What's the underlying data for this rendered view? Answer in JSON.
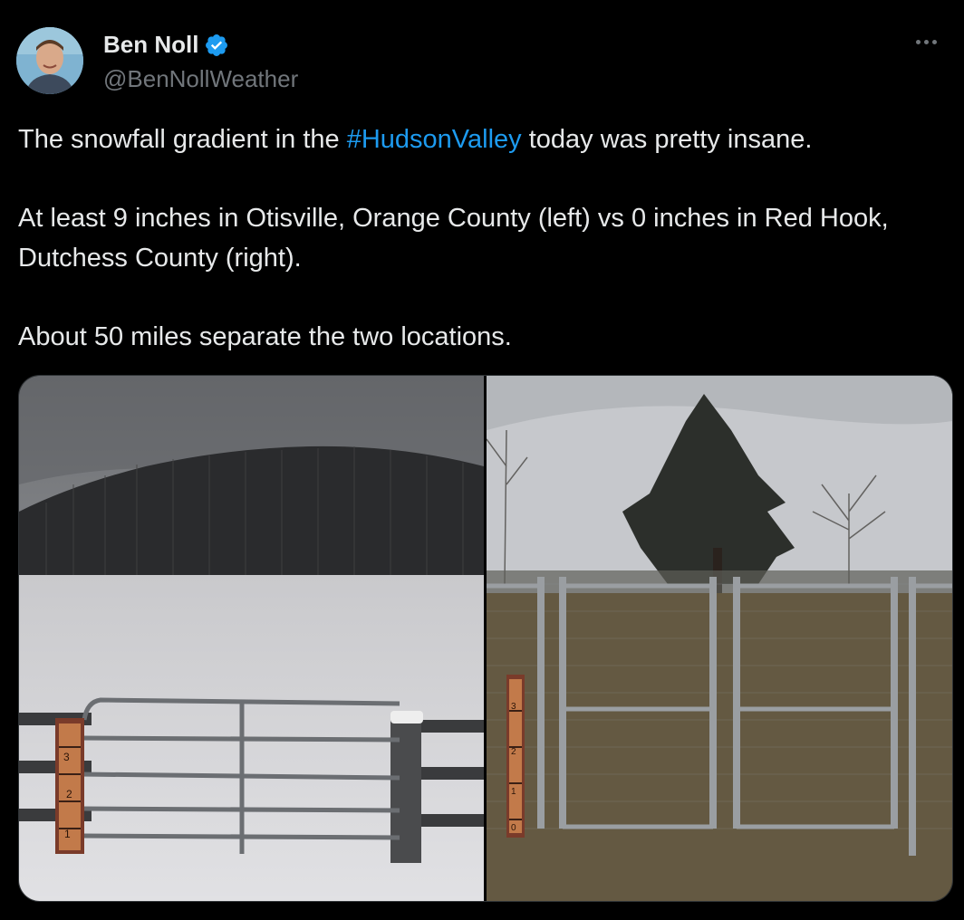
{
  "tweet": {
    "author": {
      "name": "Ben Noll",
      "handle": "@BenNollWeather",
      "verified": true,
      "verified_color": "#1d9bf0"
    },
    "text": {
      "line1_pre": "The snowfall gradient in the ",
      "hashtag": "#HudsonValley",
      "line1_post": " today was pretty insane.",
      "para2": "At least 9 inches in Otisville, Orange County (left) vs 0 inches in Red Hook, Dutchess County (right).",
      "para3": "About 50 miles separate the two locations."
    },
    "media": {
      "left_gauge_marks": [
        "3",
        "2",
        "1"
      ],
      "right_gauge_marks": [
        "3",
        "2",
        "1",
        "0"
      ]
    },
    "colors": {
      "background": "#000000",
      "text": "#e7e9ea",
      "secondary_text": "#71767b",
      "link": "#1d9bf0"
    }
  }
}
